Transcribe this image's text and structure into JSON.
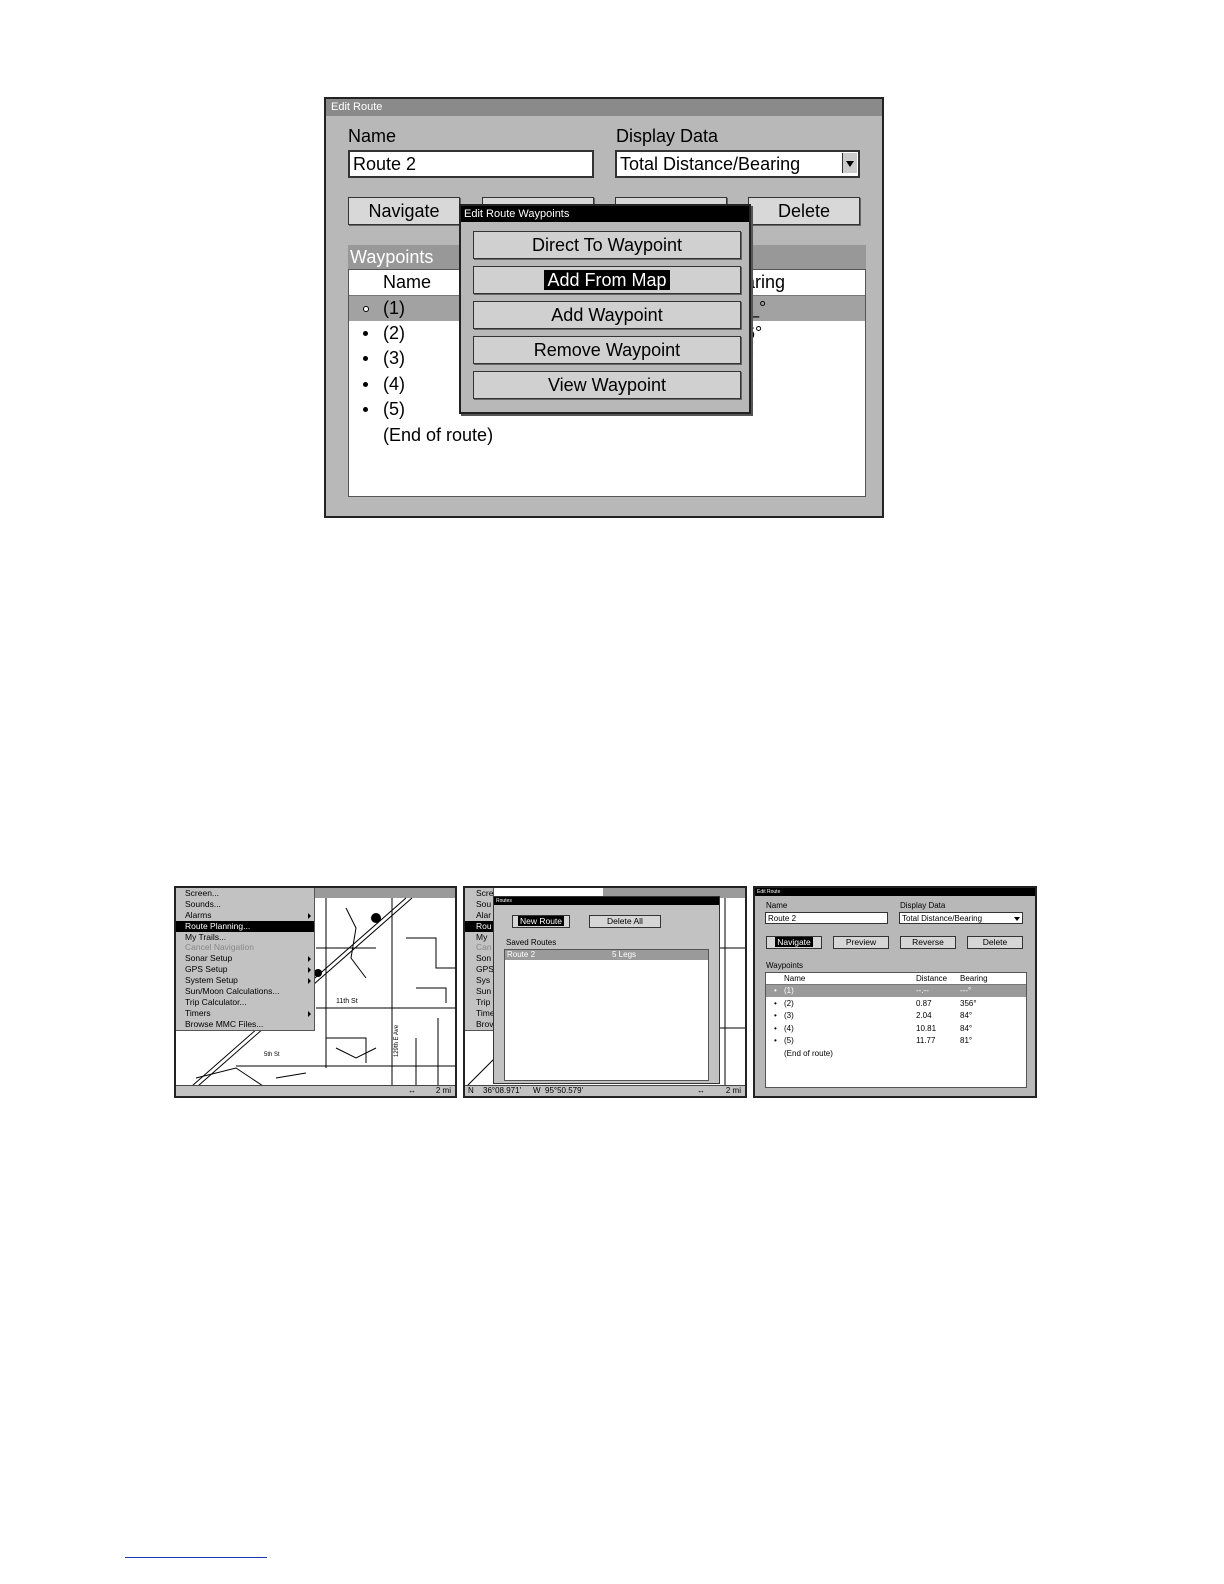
{
  "edit_route": {
    "title": "Edit Route",
    "name_label": "Name",
    "name_value": "Route 2",
    "display_label": "Display Data",
    "display_value": "Total Distance/Bearing",
    "navigate_label": "Navigate",
    "delete_label": "Delete",
    "waypoints_label": "Waypoints",
    "col_name": "Name",
    "col_bearing_partial": "aring",
    "rows": [
      {
        "name": "(1)",
        "bearing": "_°"
      },
      {
        "name": "(2)",
        "bearing": "6°"
      },
      {
        "name": "(3)",
        "bearing": "°"
      },
      {
        "name": "(4)",
        "bearing": "°"
      },
      {
        "name": "(5)",
        "bearing": "°"
      }
    ],
    "end_label": "(End of route)"
  },
  "popup": {
    "title": "Edit Route Waypoints",
    "buttons": [
      "Direct To Waypoint",
      "Add From Map",
      "Add Waypoint",
      "Remove Waypoint",
      "View Waypoint"
    ]
  },
  "menu_screen": {
    "items": [
      "Screen...",
      "Sounds...",
      "Alarms",
      "Route Planning...",
      "My Trails...",
      "Cancel Navigation",
      "Sonar Setup",
      "GPS Setup",
      "System Setup",
      "Sun/Moon Calculations...",
      "Trip Calculator...",
      "Timers",
      "Browse MMC Files..."
    ],
    "map_labels": [
      "11th St",
      "129th E Ave",
      "5th St",
      "2 mi"
    ]
  },
  "routes_screen": {
    "title": "Routes",
    "new_route": "New Route",
    "delete_all": "Delete All",
    "saved_label": "Saved Routes",
    "route_name": "Route 2",
    "route_legs": "5 Legs",
    "menu_stubs": [
      "Screen",
      "Sou",
      "Alar",
      "Rou",
      "My",
      "Can",
      "Son",
      "GPS",
      "Sys",
      "Sun",
      "Trip",
      "Time",
      "Brov"
    ],
    "status_n": "N",
    "status_lat": "36°08.971'",
    "status_w": "W",
    "status_lon": "95°50.579'",
    "scale": "2 mi"
  },
  "small_edit": {
    "title": "Edit Route",
    "name_label": "Name",
    "name_value": "Route 2",
    "display_label": "Display Data",
    "display_value": "Total Distance/Bearing",
    "buttons": [
      "Navigate",
      "Preview",
      "Reverse",
      "Delete"
    ],
    "waypoints_label": "Waypoints",
    "cols": [
      "Name",
      "Distance",
      "Bearing"
    ],
    "rows": [
      {
        "name": "(1)",
        "dist": "--.--",
        "bear": "---°"
      },
      {
        "name": "(2)",
        "dist": "0.87",
        "bear": "356°"
      },
      {
        "name": "(3)",
        "dist": "2.04",
        "bear": "84°"
      },
      {
        "name": "(4)",
        "dist": "10.81",
        "bear": "84°"
      },
      {
        "name": "(5)",
        "dist": "11.77",
        "bear": "81°"
      }
    ],
    "end_label": "(End of route)"
  }
}
